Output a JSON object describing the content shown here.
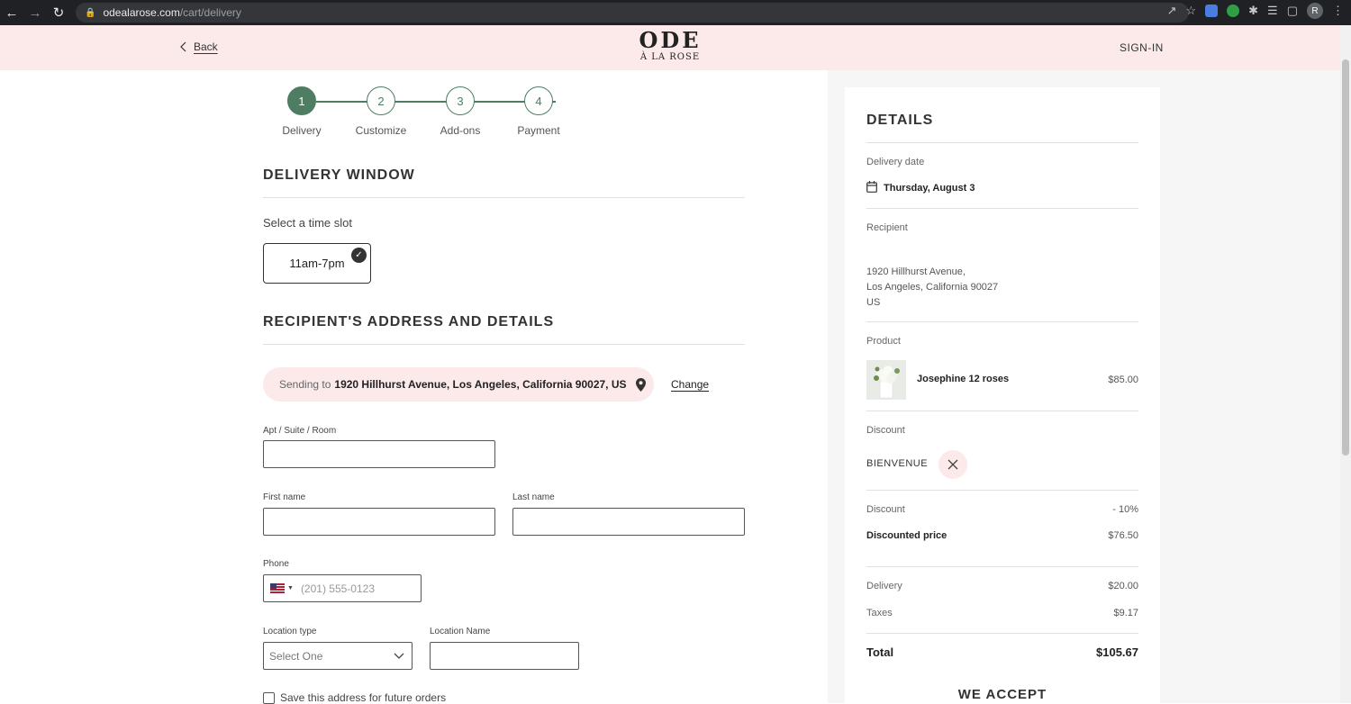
{
  "browser": {
    "url_host": "odealarose.com",
    "url_path": "/cart/delivery",
    "profile_initial": "R"
  },
  "header": {
    "back_label": "Back",
    "logo_line1": "ODE",
    "logo_line2": "À LA ROSE",
    "signin_label": "SIGN-IN"
  },
  "stepper": {
    "steps": [
      {
        "number": "1",
        "label": "Delivery",
        "active": true
      },
      {
        "number": "2",
        "label": "Customize",
        "active": false
      },
      {
        "number": "3",
        "label": "Add-ons",
        "active": false
      },
      {
        "number": "4",
        "label": "Payment",
        "active": false
      }
    ]
  },
  "delivery_window": {
    "title": "DELIVERY WINDOW",
    "select_label": "Select a time slot",
    "slot_label": "11am-7pm"
  },
  "recipient": {
    "title": "RECIPIENT'S ADDRESS AND DETAILS",
    "sending_prefix": "Sending to",
    "sending_address": "1920 Hillhurst Avenue, Los Angeles, California 90027, US",
    "change_label": "Change",
    "apt_label": "Apt / Suite / Room",
    "apt_value": "",
    "first_name_label": "First name",
    "first_name_value": "",
    "last_name_label": "Last name",
    "last_name_value": "",
    "phone_label": "Phone",
    "phone_placeholder": "(201) 555-0123",
    "location_type_label": "Location type",
    "location_type_selected": "Select One",
    "location_name_label": "Location Name",
    "location_name_value": "",
    "save_address_label": "Save this address for future orders"
  },
  "details": {
    "title": "DETAILS",
    "delivery_date_label": "Delivery date",
    "delivery_date": "Thursday, August 3",
    "recipient_label": "Recipient",
    "address_line1": "1920 Hillhurst Avenue,",
    "address_line2": "Los Angeles, California 90027",
    "address_line3": "US",
    "product_label": "Product",
    "product_name": "Josephine 12 roses",
    "product_price": "$85.00",
    "discount_label": "Discount",
    "discount_code": "BIENVENUE",
    "discount_row_label": "Discount",
    "discount_value": "- 10%",
    "discounted_price_label": "Discounted price",
    "discounted_price": "$76.50",
    "delivery_label": "Delivery",
    "delivery_price": "$20.00",
    "taxes_label": "Taxes",
    "taxes_value": "$9.17",
    "total_label": "Total",
    "total_value": "$105.67",
    "we_accept": "WE ACCEPT"
  },
  "colors": {
    "accent_green": "#4e7d63",
    "header_pink": "#fce9ea"
  }
}
